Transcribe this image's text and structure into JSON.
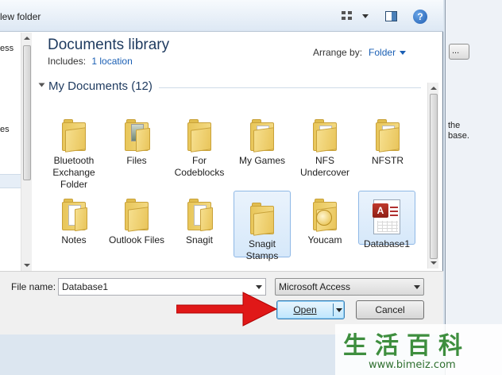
{
  "toolbar": {
    "new_folder_label": "lew folder",
    "view_icon": "views-icon",
    "pane_icon": "preview-pane-icon",
    "help_label": "?"
  },
  "nav": {
    "item1": "ess",
    "item2": "es"
  },
  "library": {
    "title": "Documents library",
    "includes_label": "Includes:",
    "includes_link": "1 location",
    "arrange_label": "Arrange by:",
    "arrange_value": "Folder"
  },
  "group": {
    "title": "My Documents (12)"
  },
  "items": [
    {
      "label": "Bluetooth Exchange Folder",
      "icon": "folder-icon"
    },
    {
      "label": "Files",
      "icon": "folder-icon"
    },
    {
      "label": "For Codeblocks",
      "icon": "folder-icon"
    },
    {
      "label": "My Games",
      "icon": "folder-icon"
    },
    {
      "label": "NFS Undercover",
      "icon": "folder-icon"
    },
    {
      "label": "NFSTR",
      "icon": "folder-icon"
    },
    {
      "label": "Notes",
      "icon": "folder-icon"
    },
    {
      "label": "Outlook Files",
      "icon": "folder-icon"
    },
    {
      "label": "Snagit",
      "icon": "folder-icon"
    },
    {
      "label": "Snagit Stamps",
      "icon": "folder-icon"
    },
    {
      "label": "Youcam",
      "icon": "folder-icon"
    },
    {
      "label": "Database1",
      "icon": "access-database-icon"
    }
  ],
  "bottom": {
    "file_name_label": "File name:",
    "file_name_value": "Database1",
    "file_type_value": "Microsoft Access",
    "open_label": "Open",
    "cancel_label": "Cancel"
  },
  "background_window": {
    "button_label": "...",
    "text": "the\nbase."
  },
  "watermark": {
    "chinese": "生活百科",
    "url": "www.bimeiz.com"
  }
}
